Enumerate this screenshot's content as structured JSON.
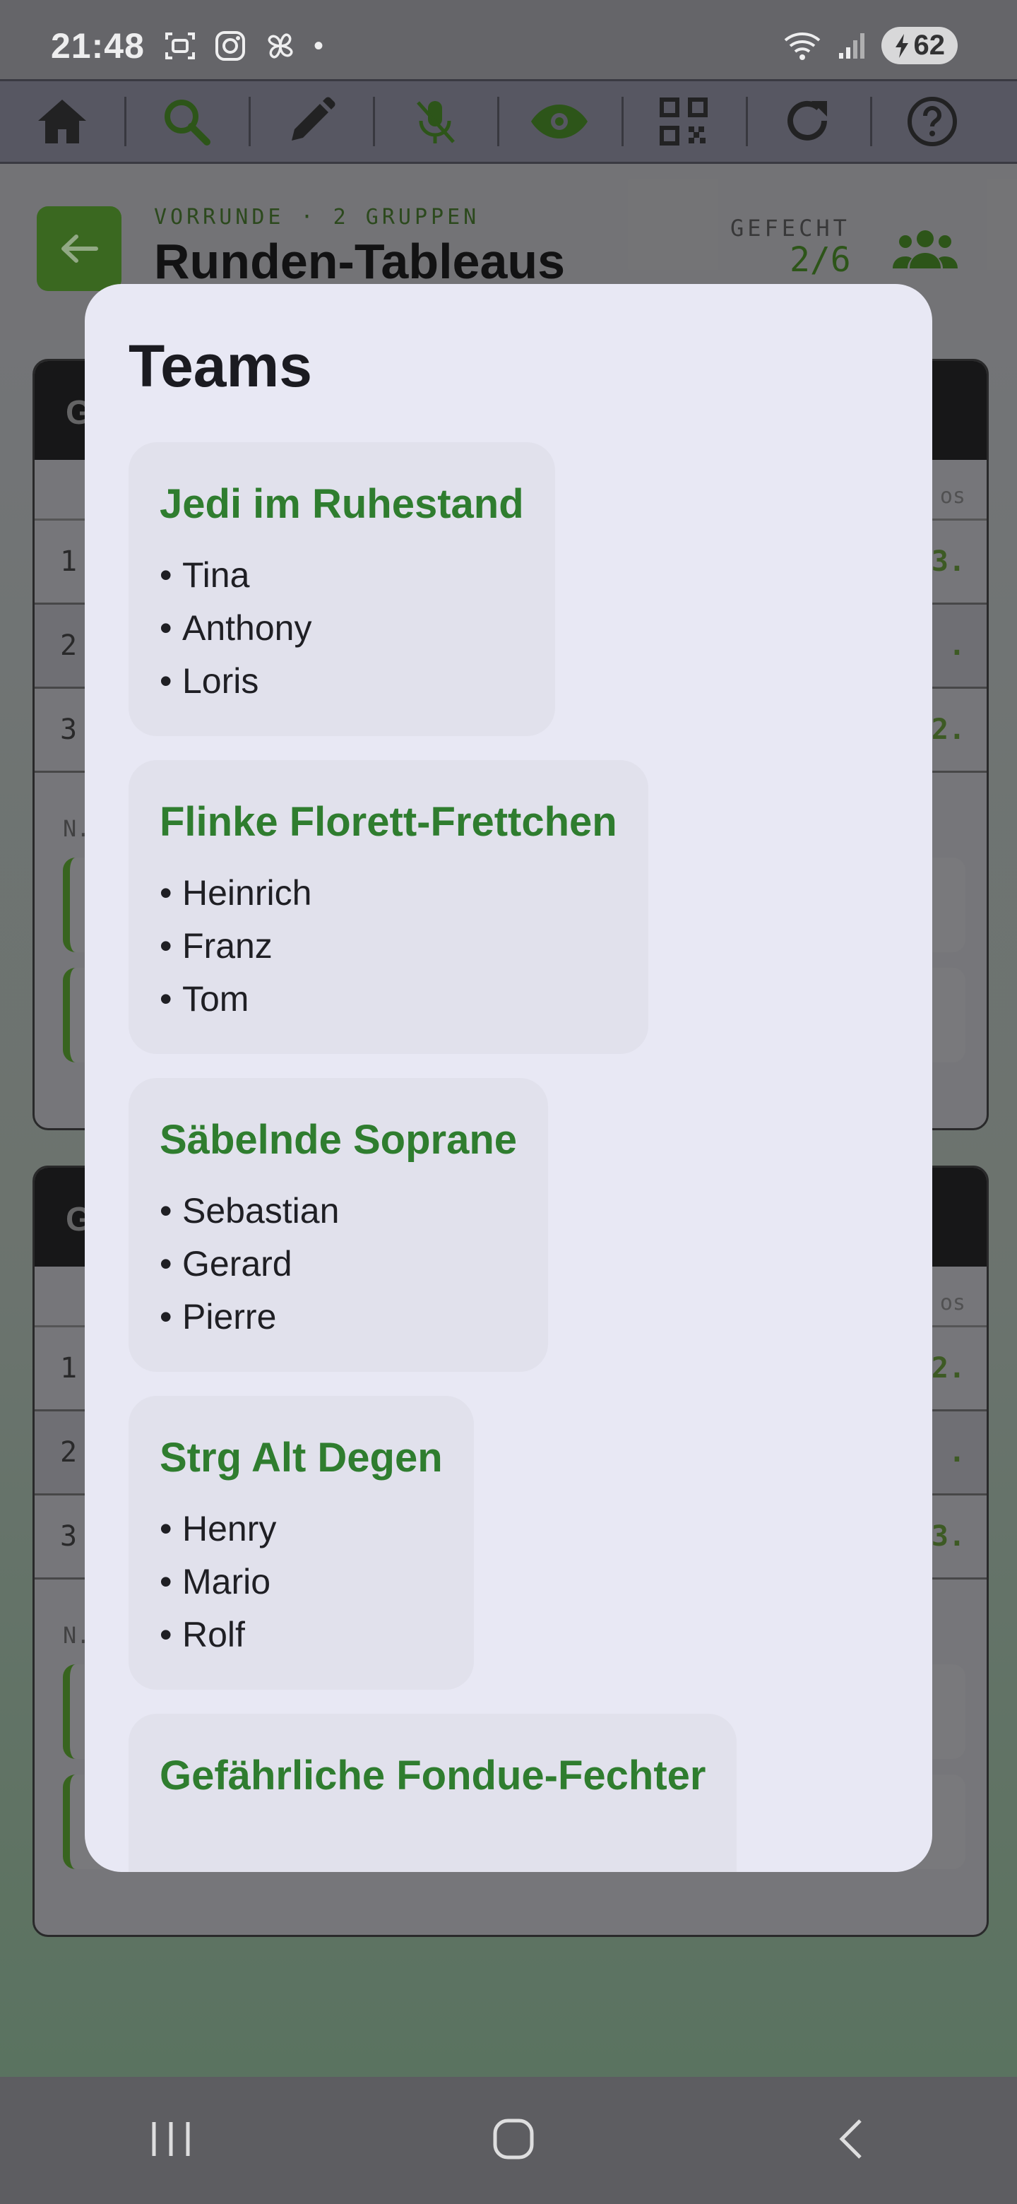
{
  "status_bar": {
    "time": "21:48",
    "dot": "•",
    "battery": "62"
  },
  "header": {
    "subtitle": "VORRUNDE · 2 GRUPPEN",
    "title": "Runden-Tableaus",
    "gefecht_label": "GEFECHT",
    "gefecht_value": "2/6"
  },
  "background": {
    "groups": [
      {
        "head": "G",
        "col_label": "os",
        "rows": [
          {
            "num": "1",
            "score": "3."
          },
          {
            "num": "2",
            "score": "."
          },
          {
            "num": "3",
            "score": "2."
          }
        ],
        "foot": "N."
      },
      {
        "head": "G",
        "col_label": "os",
        "rows": [
          {
            "num": "1",
            "score": "2."
          },
          {
            "num": "2",
            "score": "."
          },
          {
            "num": "3",
            "score": "3."
          }
        ],
        "foot": "N."
      }
    ]
  },
  "dialog": {
    "title": "Teams",
    "bullet": "•",
    "teams": [
      {
        "name": "Jedi im Ruhestand",
        "members": [
          "Tina",
          "Anthony",
          "Loris"
        ]
      },
      {
        "name": "Flinke Florett-Frettchen",
        "members": [
          "Heinrich",
          "Franz",
          "Tom"
        ]
      },
      {
        "name": "Säbelnde Soprane",
        "members": [
          "Sebastian",
          "Gerard",
          "Pierre"
        ]
      },
      {
        "name": "Strg Alt Degen",
        "members": [
          "Henry",
          "Mario",
          "Rolf"
        ]
      },
      {
        "name": "Gefährliche Fondue-Fechter",
        "members": []
      }
    ]
  },
  "colors": {
    "accent_green": "#2f7d2f",
    "dialog_bg": "#e8e8f4",
    "card_bg": "#e1e1ec"
  }
}
